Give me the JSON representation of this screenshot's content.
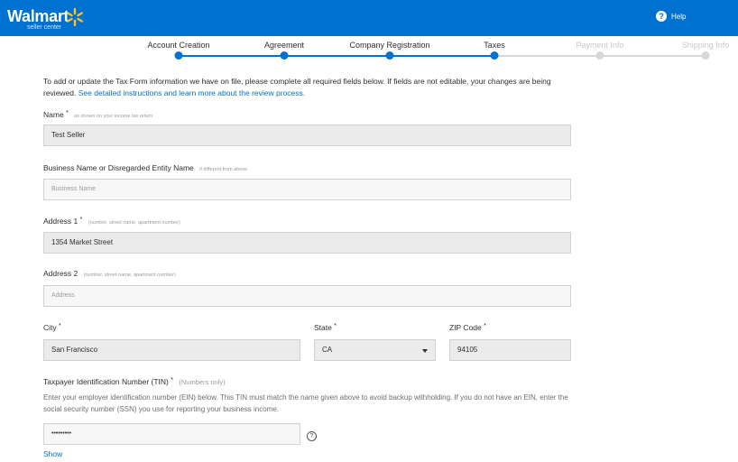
{
  "header": {
    "logo": "Walmart",
    "logo_sub": "seller center",
    "help_label": "Help"
  },
  "stepper": {
    "steps": [
      {
        "label": "Account Creation"
      },
      {
        "label": "Agreement"
      },
      {
        "label": "Company Registration"
      },
      {
        "label": "Taxes"
      },
      {
        "label": "Payment Info"
      },
      {
        "label": "Shipping Info"
      }
    ]
  },
  "form": {
    "intro": "To add or update the Tax Form information we have on file, please complete all required fields below. If fields are not editable, your changes are being reviewed.",
    "intro_link": "See detailed instructions and learn more about the review process.",
    "name": {
      "label": "Name",
      "hint": "as shown on your income tax return",
      "value": "Test Seller"
    },
    "business_name": {
      "label": "Business Name or Disregarded Entity Name",
      "hint": "if different from above",
      "placeholder": "Business Name"
    },
    "address1": {
      "label": "Address 1",
      "hint": "(number, street name, apartment number)",
      "value": "1354 Market Street"
    },
    "address2": {
      "label": "Address 2",
      "hint": "(number, street name, apartment number)",
      "placeholder": "Address"
    },
    "city": {
      "label": "City",
      "value": "San Francisco"
    },
    "state": {
      "label": "State",
      "value": "CA"
    },
    "zip": {
      "label": "ZIP Code",
      "value": "94105"
    },
    "tin": {
      "label": "Taxpayer Identification Number (TIN)",
      "hint": "(Numbers only)",
      "description": "Enter your employer identification number (EIN) below. This TIN must match the name given above to avoid backup withholding. If you do not have an EIN, enter the social security number (SSN) you use for reporting your business income.",
      "value": "•••••••••",
      "show_label": "Show"
    },
    "required_mark": "*"
  },
  "colors": {
    "brand": "#0071ce",
    "spark": "#ffc220",
    "field_bg": "#ebebeb"
  }
}
